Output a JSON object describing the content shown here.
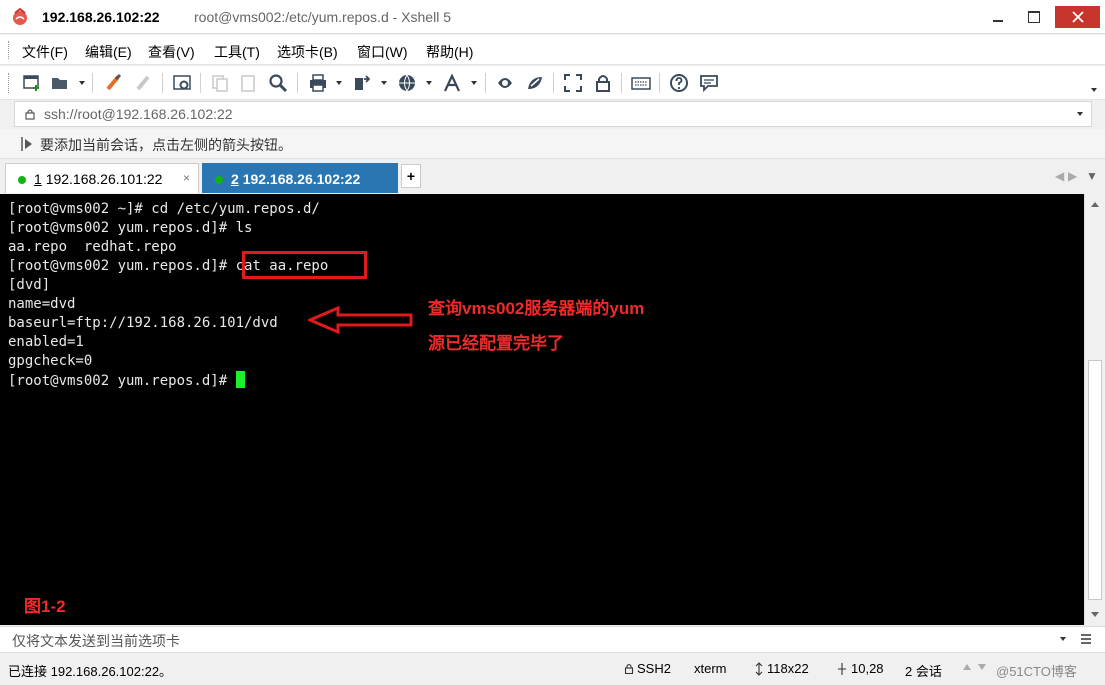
{
  "window": {
    "host": "192.168.26.102:22",
    "subtitle": "root@vms002:/etc/yum.repos.d - Xshell 5"
  },
  "menu": [
    "文件(F)",
    "编辑(E)",
    "查看(V)",
    "工具(T)",
    "选项卡(B)",
    "窗口(W)",
    "帮助(H)"
  ],
  "address": {
    "value": "ssh://root@192.168.26.102:22"
  },
  "hint": "要添加当前会话，点击左侧的箭头按钮。",
  "tabs": [
    {
      "number": "1",
      "host": "192.168.26.101:22",
      "close": "×",
      "status_color": "#10b310"
    },
    {
      "number": "2",
      "host": "192.168.26.102:22",
      "close": "×",
      "status_color": "#10b310"
    }
  ],
  "tab_add": "+",
  "terminal": {
    "lines": [
      "[root@vms002 ~]# cd /etc/yum.repos.d/",
      "[root@vms002 yum.repos.d]# ls",
      "aa.repo  redhat.repo",
      "[root@vms002 yum.repos.d]# cat aa.repo",
      "[dvd]",
      "name=dvd",
      "baseurl=ftp://192.168.26.101/dvd",
      "enabled=1",
      "gpgcheck=0",
      "[root@vms002 yum.repos.d]# "
    ],
    "cursor_color": "#1cf02a"
  },
  "annotation": {
    "line1": "查询vms002服务器端的yum",
    "line2": "源已经配置完毕了",
    "figure": "图1-2",
    "color": "#ee2a2a"
  },
  "compose": {
    "placeholder": "仅将文本发送到当前选项卡"
  },
  "status": {
    "connected": "已连接 192.168.26.102:22。",
    "protocol": "SSH2",
    "term": "xterm",
    "size": "118x22",
    "position": "10,28",
    "sessions": "2 会话",
    "watermark": "@51CTO博客"
  }
}
